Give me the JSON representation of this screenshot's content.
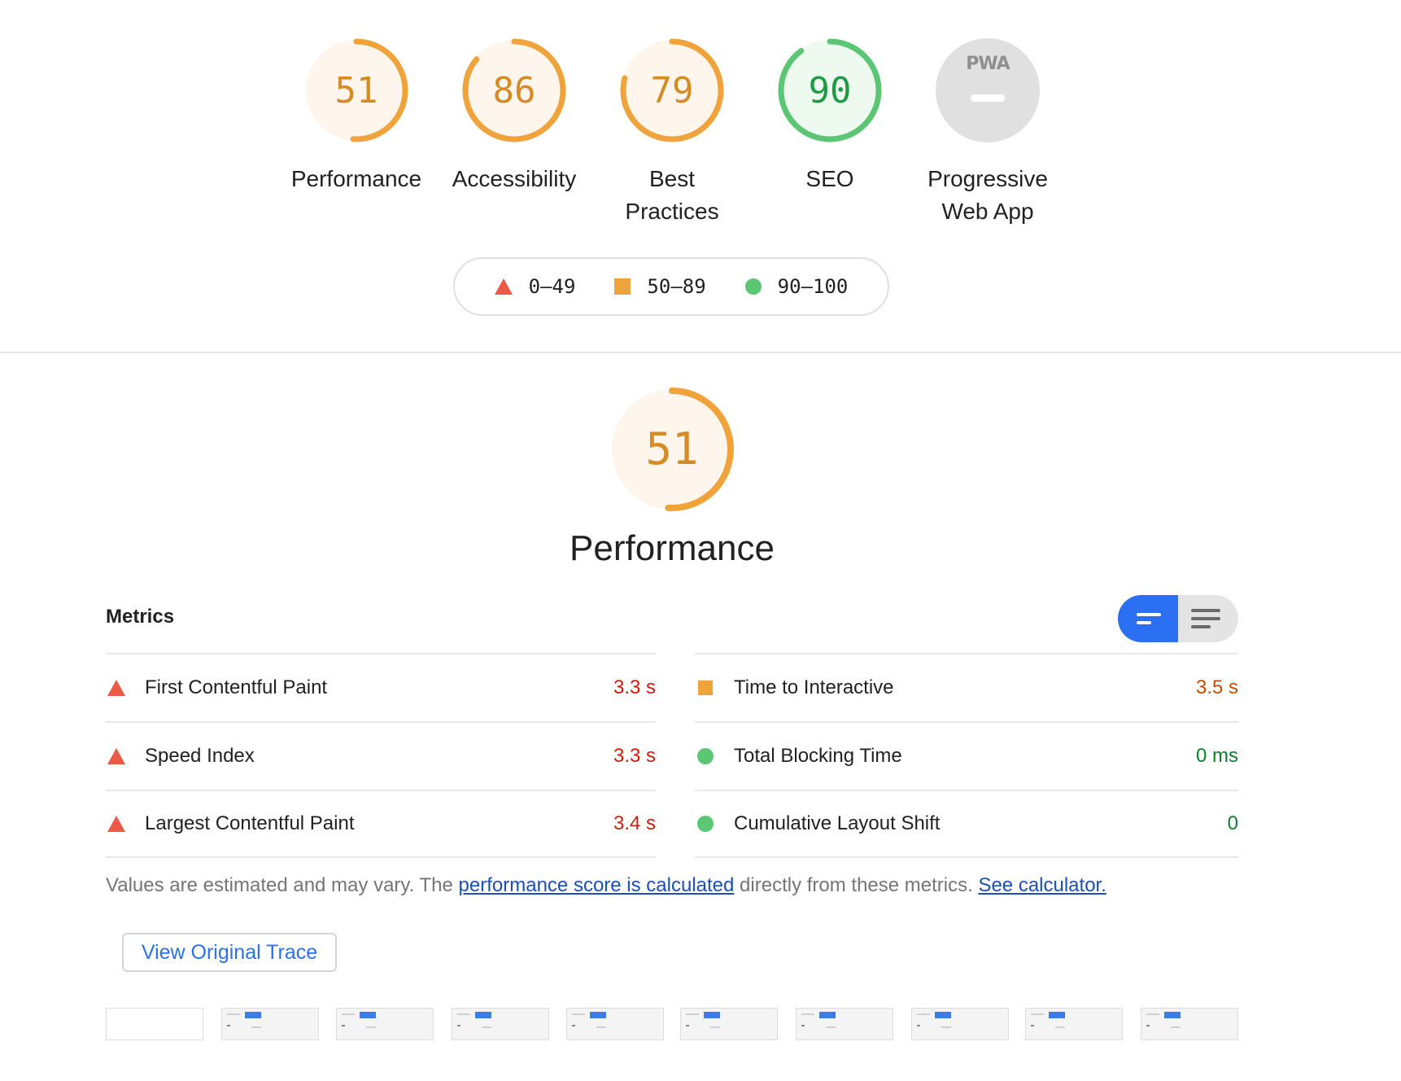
{
  "categories": [
    {
      "score": "51",
      "label": "Performance",
      "fraction": 0.51,
      "color": "#f0a33a",
      "fill": "#fef5ec"
    },
    {
      "score": "86",
      "label": "Accessibility",
      "fraction": 0.86,
      "color": "#f0a33a",
      "fill": "#fef5ec"
    },
    {
      "score": "79",
      "label_line1": "Best",
      "label_line2": "Practices",
      "fraction": 0.79,
      "color": "#f0a33a",
      "fill": "#fef5ec"
    },
    {
      "score": "90",
      "label": "SEO",
      "fraction": 0.9,
      "color": "#5bc774",
      "fill": "#eef9f0"
    },
    {
      "badge": "PWA",
      "label_line1": "Progressive",
      "label_line2": "Web App",
      "color": "#e0e0e0"
    }
  ],
  "legend": {
    "fail": "0–49",
    "average": "50–89",
    "pass": "90–100"
  },
  "performance": {
    "score": "51",
    "fraction": 0.51,
    "title": "Performance"
  },
  "metrics": {
    "title": "Metrics",
    "left": [
      {
        "name": "First Contentful Paint",
        "value": "3.3 s",
        "status": "fail"
      },
      {
        "name": "Speed Index",
        "value": "3.3 s",
        "status": "fail"
      },
      {
        "name": "Largest Contentful Paint",
        "value": "3.4 s",
        "status": "fail"
      }
    ],
    "right": [
      {
        "name": "Time to Interactive",
        "value": "3.5 s",
        "status": "average"
      },
      {
        "name": "Total Blocking Time",
        "value": "0 ms",
        "status": "pass"
      },
      {
        "name": "Cumulative Layout Shift",
        "value": "0",
        "status": "pass"
      }
    ]
  },
  "note": {
    "prefix": "Values are estimated and may vary. The ",
    "link1": "performance score is calculated",
    "middle": " directly from these metrics. ",
    "link2": "See calculator."
  },
  "trace_button": "View Original Trace",
  "colors": {
    "fail": "#eb5a46",
    "average": "#f0a33a",
    "pass": "#5bc774",
    "accent": "#2b6ff2"
  }
}
